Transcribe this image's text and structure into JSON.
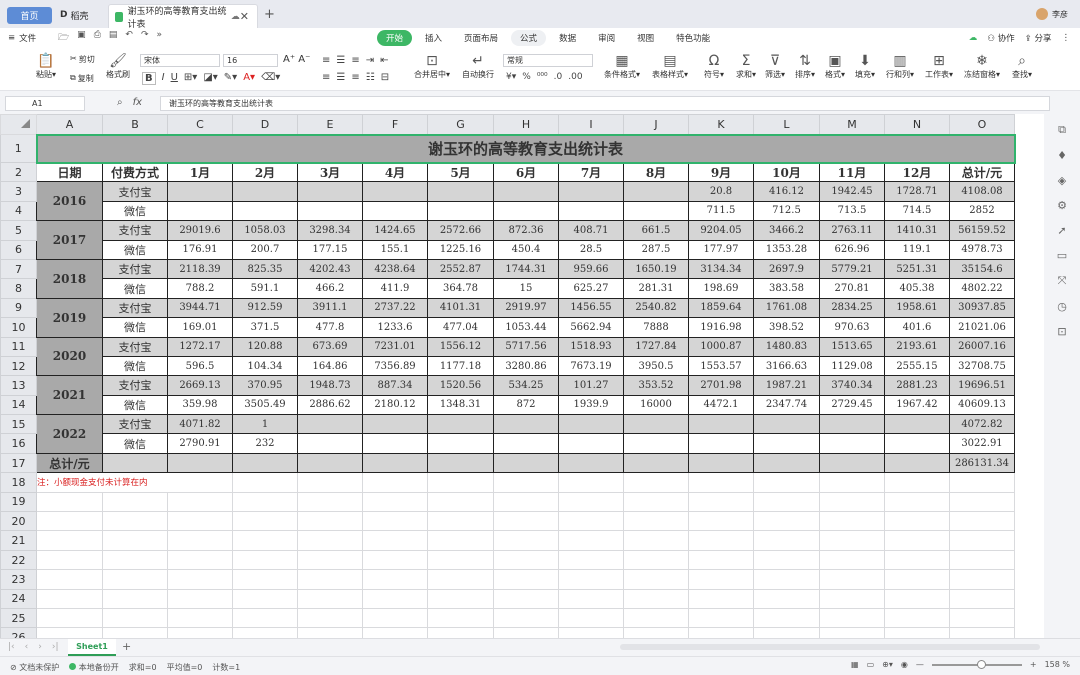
{
  "tabs": {
    "home": "首页",
    "doc": "稻壳",
    "active": "谢玉环的高等教育支出统计表"
  },
  "user": {
    "name": "李彦"
  },
  "menubar": {
    "file": "文件",
    "tabs": [
      "开始",
      "插入",
      "页面布局",
      "公式",
      "数据",
      "审阅",
      "视图",
      "特色功能"
    ],
    "active_tab": "开始",
    "right": [
      "协作",
      "分享"
    ]
  },
  "ribbon": {
    "paste": "粘贴",
    "cut": "剪切",
    "copy": "复制",
    "format_painter": "格式刷",
    "font_name": "宋体",
    "font_size": "16",
    "number_format": "常规",
    "merge": "合并居中",
    "wrap": "自动换行",
    "cond_format": "条件格式",
    "table_style": "表格样式",
    "symbol": "符号",
    "sum": "求和",
    "filter": "筛选",
    "sort": "排序",
    "format": "格式",
    "fill": "填充",
    "rowcol": "行和列",
    "worksheet": "工作表",
    "freeze": "冻结窗格",
    "find": "查找"
  },
  "formula": {
    "cell_ref": "A1",
    "content": "谢玉环的高等教育支出统计表"
  },
  "columns": [
    "A",
    "B",
    "C",
    "D",
    "E",
    "F",
    "G",
    "H",
    "I",
    "J",
    "K",
    "L",
    "M",
    "N",
    "O"
  ],
  "table": {
    "title": "谢玉环的高等教育支出统计表",
    "header": [
      "日期",
      "付费方式",
      "1月",
      "2月",
      "3月",
      "4月",
      "5月",
      "6月",
      "7月",
      "8月",
      "9月",
      "10月",
      "11月",
      "12月",
      "总计/元"
    ],
    "years": [
      {
        "year": "2016",
        "alipay": [
          "",
          "",
          "",
          "",
          "",
          "",
          "",
          "",
          "20.8",
          "416.12",
          "1942.45",
          "1728.71",
          "4108.08"
        ],
        "wechat": [
          "",
          "",
          "",
          "",
          "",
          "",
          "",
          "",
          "711.5",
          "712.5",
          "713.5",
          "714.5",
          "2852"
        ]
      },
      {
        "year": "2017",
        "alipay": [
          "29019.6",
          "1058.03",
          "3298.34",
          "1424.65",
          "2572.66",
          "872.36",
          "408.71",
          "661.5",
          "9204.05",
          "3466.2",
          "2763.11",
          "1410.31",
          "56159.52"
        ],
        "wechat": [
          "176.91",
          "200.7",
          "177.15",
          "155.1",
          "1225.16",
          "450.4",
          "28.5",
          "287.5",
          "177.97",
          "1353.28",
          "626.96",
          "119.1",
          "4978.73"
        ]
      },
      {
        "year": "2018",
        "alipay": [
          "2118.39",
          "825.35",
          "4202.43",
          "4238.64",
          "2552.87",
          "1744.31",
          "959.66",
          "1650.19",
          "3134.34",
          "2697.9",
          "5779.21",
          "5251.31",
          "35154.6"
        ],
        "wechat": [
          "788.2",
          "591.1",
          "466.2",
          "411.9",
          "364.78",
          "15",
          "625.27",
          "281.31",
          "198.69",
          "383.58",
          "270.81",
          "405.38",
          "4802.22"
        ]
      },
      {
        "year": "2019",
        "alipay": [
          "3944.71",
          "912.59",
          "3911.1",
          "2737.22",
          "4101.31",
          "2919.97",
          "1456.55",
          "2540.82",
          "1859.64",
          "1761.08",
          "2834.25",
          "1958.61",
          "30937.85"
        ],
        "wechat": [
          "169.01",
          "371.5",
          "477.8",
          "1233.6",
          "477.04",
          "1053.44",
          "5662.94",
          "7888",
          "1916.98",
          "398.52",
          "970.63",
          "401.6",
          "21021.06"
        ]
      },
      {
        "year": "2020",
        "alipay": [
          "1272.17",
          "120.88",
          "673.69",
          "7231.01",
          "1556.12",
          "5717.56",
          "1518.93",
          "1727.84",
          "1000.87",
          "1480.83",
          "1513.65",
          "2193.61",
          "26007.16"
        ],
        "wechat": [
          "596.5",
          "104.34",
          "164.86",
          "7356.89",
          "1177.18",
          "3280.86",
          "7673.19",
          "3950.5",
          "1553.57",
          "3166.63",
          "1129.08",
          "2555.15",
          "32708.75"
        ]
      },
      {
        "year": "2021",
        "alipay": [
          "2669.13",
          "370.95",
          "1948.73",
          "887.34",
          "1520.56",
          "534.25",
          "101.27",
          "353.52",
          "2701.98",
          "1987.21",
          "3740.34",
          "2881.23",
          "19696.51"
        ],
        "wechat": [
          "359.98",
          "3505.49",
          "2886.62",
          "2180.12",
          "1348.31",
          "872",
          "1939.9",
          "16000",
          "4472.1",
          "2347.74",
          "2729.45",
          "1967.42",
          "40609.13"
        ]
      },
      {
        "year": "2022",
        "alipay": [
          "4071.82",
          "1",
          "",
          "",
          "",
          "",
          "",
          "",
          "",
          "",
          "",
          "",
          "4072.82"
        ],
        "wechat": [
          "2790.91",
          "232",
          "",
          "",
          "",
          "",
          "",
          "",
          "",
          "",
          "",
          "",
          "3022.91"
        ]
      }
    ],
    "alipay_label": "支付宝",
    "wechat_label": "微信",
    "total_label": "总计/元",
    "grand_total": "286131.34",
    "note": "注：小额现金支付未计算在内"
  },
  "sheet_tab": "Sheet1",
  "status": {
    "protect": "文档未保护",
    "backup": "本地备份开",
    "sum": "求和=0",
    "avg": "平均值=0",
    "count": "计数=1",
    "zoom": "158 %"
  }
}
